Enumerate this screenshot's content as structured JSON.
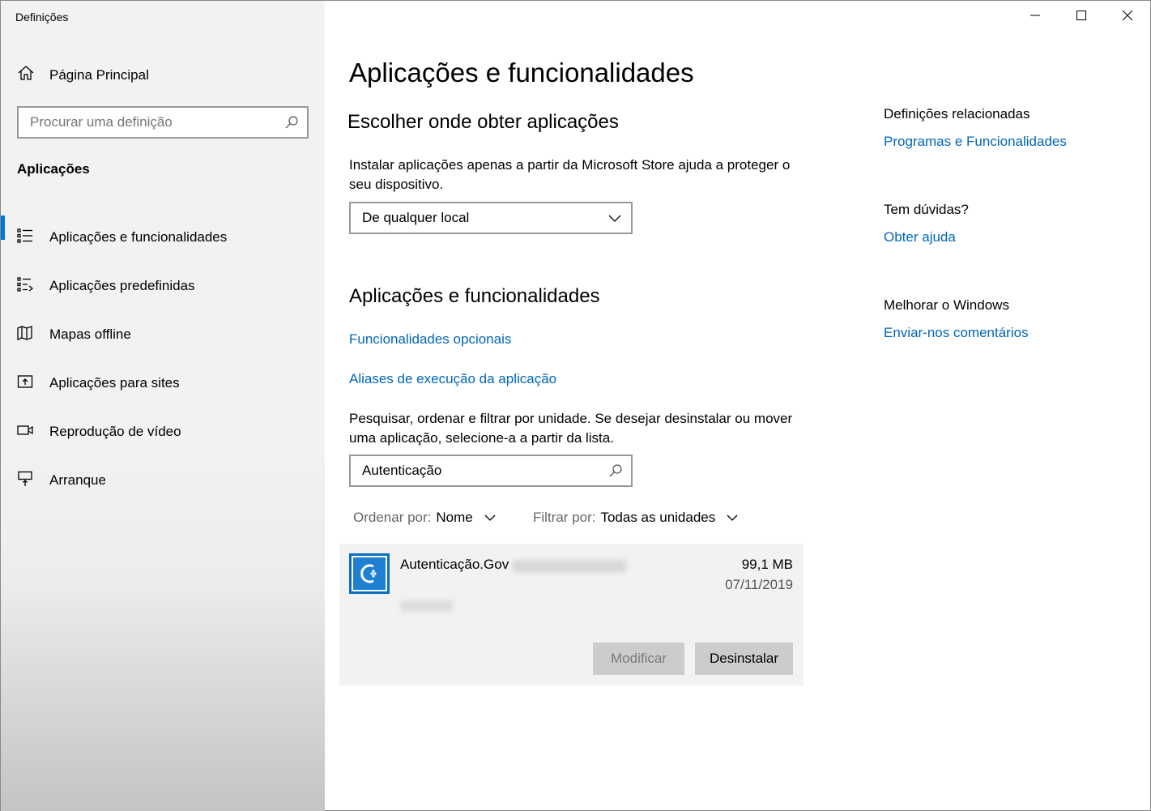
{
  "window": {
    "title": "Definições"
  },
  "sidebar": {
    "home_label": "Página Principal",
    "search_placeholder": "Procurar uma definição",
    "section_label": "Aplicações",
    "items": [
      {
        "label": "Aplicações e funcionalidades",
        "icon": "apps-features-icon",
        "active": true
      },
      {
        "label": "Aplicações predefinidas",
        "icon": "default-apps-icon"
      },
      {
        "label": "Mapas offline",
        "icon": "offline-maps-icon"
      },
      {
        "label": "Aplicações para sites",
        "icon": "apps-for-websites-icon"
      },
      {
        "label": "Reprodução de vídeo",
        "icon": "video-playback-icon"
      },
      {
        "label": "Arranque",
        "icon": "startup-icon"
      }
    ]
  },
  "main": {
    "title": "Aplicações e funcionalidades",
    "choose_heading": "Escolher onde obter aplicações",
    "choose_desc": "Instalar aplicações apenas a partir da Microsoft Store ajuda a proteger o seu dispositivo.",
    "source_select_value": "De qualquer local",
    "apps_heading": "Aplicações e funcionalidades",
    "optional_features_link": "Funcionalidades opcionais",
    "aliases_link": "Aliases de execução da aplicação",
    "search_desc": "Pesquisar, ordenar e filtrar por unidade. Se desejar desinstalar ou mover uma aplicação, selecione-a a partir da lista.",
    "app_search_value": "Autenticação",
    "sort_label": "Ordenar por:",
    "sort_value": "Nome",
    "filter_label": "Filtrar por:",
    "filter_value": "Todas as unidades",
    "app": {
      "name": "Autenticação.Gov",
      "size": "99,1 MB",
      "date": "07/11/2019",
      "modify_label": "Modificar",
      "uninstall_label": "Desinstalar"
    }
  },
  "related": {
    "related_heading": "Definições relacionadas",
    "programs_link": "Programas e Funcionalidades",
    "questions_heading": "Tem dúvidas?",
    "help_link": "Obter ajuda",
    "improve_heading": "Melhorar o Windows",
    "feedback_link": "Enviar-nos comentários"
  },
  "colors": {
    "accent": "#0078d7",
    "link": "#0067b8",
    "app_icon": "#0a6fc2"
  }
}
